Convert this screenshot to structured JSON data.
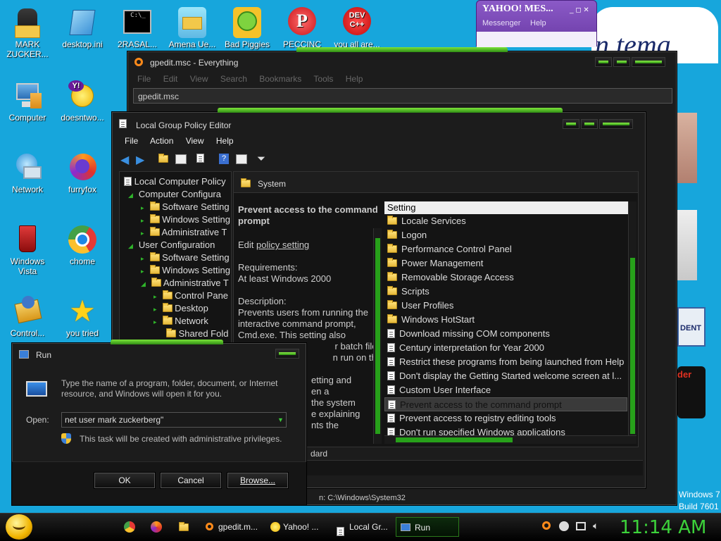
{
  "desktop": {
    "icons": [
      {
        "label": "MARK ZUCKER..."
      },
      {
        "label": "desktop.ini"
      },
      {
        "label": "2RASAL..."
      },
      {
        "label": "Amena Ue..."
      },
      {
        "label": "Bad Piggies"
      },
      {
        "label": "PECCINC"
      },
      {
        "label": "you all are..."
      },
      {
        "label": "Computer"
      },
      {
        "label": "doesntwo..."
      },
      {
        "label": "Network"
      },
      {
        "label": "furryfox"
      },
      {
        "label": "Windows Vista"
      },
      {
        "label": "chome"
      },
      {
        "label": "Control..."
      },
      {
        "label": "you tried"
      }
    ],
    "watermark": {
      "line1": "Windows 7",
      "line2": "Build 7601"
    },
    "partial_text": {
      "right1": "DENT",
      "right2": "der",
      "bg": "n tema"
    }
  },
  "yahoo": {
    "title": "YAHOO! MES...",
    "tab1": "Messenger",
    "tab2": "Help"
  },
  "everything": {
    "title": "gpedit.msc - Everything",
    "menu": [
      "File",
      "Edit",
      "View",
      "Search",
      "Bookmarks",
      "Tools",
      "Help"
    ],
    "search_value": "gpedit.msc",
    "status": "n: C:\\Windows\\System32"
  },
  "gpe": {
    "title": "Local Group Policy Editor",
    "menu": [
      "File",
      "Action",
      "View",
      "Help"
    ],
    "tree": [
      "Local Computer Policy",
      "Computer Configura",
      "Software Setting",
      "Windows Setting",
      "Administrative T",
      "User Configuration",
      "Software Setting",
      "Windows Setting",
      "Administrative T",
      "Control Pane",
      "Desktop",
      "Network",
      "Shared Fold"
    ],
    "header": "System",
    "desc": {
      "title": "Prevent access to the command prompt",
      "edit_prefix": "Edit ",
      "edit_link": "policy setting",
      "req_label": "Requirements:",
      "req_value": "At least Windows 2000",
      "desc_label": "Description:",
      "desc_lines": [
        "Prevents users from running the",
        "interactive command prompt,",
        "Cmd.exe. This setting also",
        "r batch files",
        "n run on the",
        "",
        "etting and",
        "en a",
        "the system",
        "e explaining",
        "nts the"
      ]
    },
    "list_header": "Setting",
    "settings": [
      {
        "name": "Locale Services",
        "type": "folder"
      },
      {
        "name": "Logon",
        "type": "folder"
      },
      {
        "name": "Performance Control Panel",
        "type": "folder"
      },
      {
        "name": "Power Management",
        "type": "folder"
      },
      {
        "name": "Removable Storage Access",
        "type": "folder"
      },
      {
        "name": "Scripts",
        "type": "folder"
      },
      {
        "name": "User Profiles",
        "type": "folder"
      },
      {
        "name": "Windows HotStart",
        "type": "folder"
      },
      {
        "name": "Download missing COM components",
        "type": "doc"
      },
      {
        "name": "Century interpretation for Year 2000",
        "type": "doc"
      },
      {
        "name": "Restrict these programs from being launched from Help",
        "type": "doc"
      },
      {
        "name": "Don't display the Getting Started welcome screen at l...",
        "type": "doc"
      },
      {
        "name": "Custom User Interface",
        "type": "doc"
      },
      {
        "name": "Prevent access to the command prompt",
        "type": "doc"
      },
      {
        "name": "Prevent access to registry editing tools",
        "type": "doc"
      },
      {
        "name": "Don't run specified Windows applications",
        "type": "doc"
      }
    ],
    "tab_partial": "dard"
  },
  "run": {
    "title": "Run",
    "description": "Type the name of a program, folder, document, or Internet resource, and Windows will open it for you.",
    "open_label": "Open:",
    "input_value": "net user mark zuckerberg\"",
    "admin_note": "This task will be created with administrative privileges.",
    "ok": "OK",
    "cancel": "Cancel",
    "browse": "Browse..."
  },
  "taskbar": {
    "items": [
      {
        "label": "gpedit.m..."
      },
      {
        "label": "Yahoo! ..."
      },
      {
        "label": "Local Gr..."
      },
      {
        "label": "Run"
      }
    ],
    "clock": "11:14 AM"
  }
}
